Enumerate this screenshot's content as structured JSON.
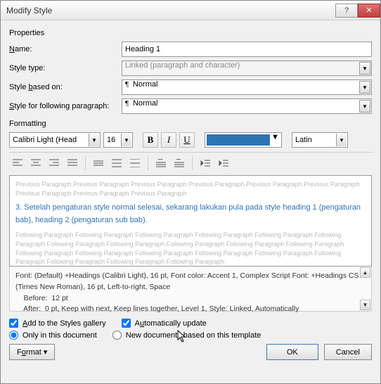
{
  "title": "Modify Style",
  "properties_label": "Properties",
  "name_label": "Name:",
  "name_value": "Heading 1",
  "styletype_label": "Style type:",
  "styletype_value": "Linked (paragraph and character)",
  "basedon_label_pre": "Style ",
  "basedon_label_u": "b",
  "basedon_label_post": "ased on:",
  "basedon_value": "Normal",
  "following_label_pre": "",
  "following_label_u": "S",
  "following_label_post": "tyle for following paragraph:",
  "following_value": "Normal",
  "formatting_label": "Formatting",
  "font_name": "Calibri Light (Head",
  "font_size": "16",
  "script_value": "Latin",
  "preview_prev": "Previous Paragraph Previous Paragraph Previous Paragraph Previous Paragraph Previous Paragraph Previous Paragraph Previous Paragraph Previous Paragraph Previous Paragraph",
  "preview_sample": "3. Setelah pengaturan style normal selesai, sekarang lakukan pula pada style heading 1 (pengaturan bab), heading 2 (pengaturan sub bab).",
  "preview_post": "Following Paragraph Following Paragraph Following Paragraph Following Paragraph Following Paragraph Following Paragraph Following Paragraph Following Paragraph Following Paragraph Following Paragraph Following Paragraph Following Paragraph Following Paragraph Following Paragraph Following Paragraph Following Paragraph Following Paragraph Following Paragraph Following Paragraph Following Paragraph",
  "desc_line1": "Font: (Default) +Headings (Calibri Light), 16 pt, Font color: Accent 1, Complex Script Font: +Headings CS (Times New Roman), 16 pt, Left-to-right, Space",
  "desc_line2": "    Before:  12 pt",
  "desc_line3": "    After:  0 pt, Keep with next, Keep lines together, Level 1, Style: Linked, Automatically",
  "add_gallery_label": "Add to the Styles gallery",
  "auto_update_label_u": "A",
  "auto_update_label_post": "utomatically update",
  "only_doc_label": "Only in this document",
  "new_tmpl_label": "New documents based on this template",
  "format_btn": "Format ▾",
  "ok_btn": "OK",
  "cancel_btn": "Cancel",
  "color_accent": "#2e74b5"
}
